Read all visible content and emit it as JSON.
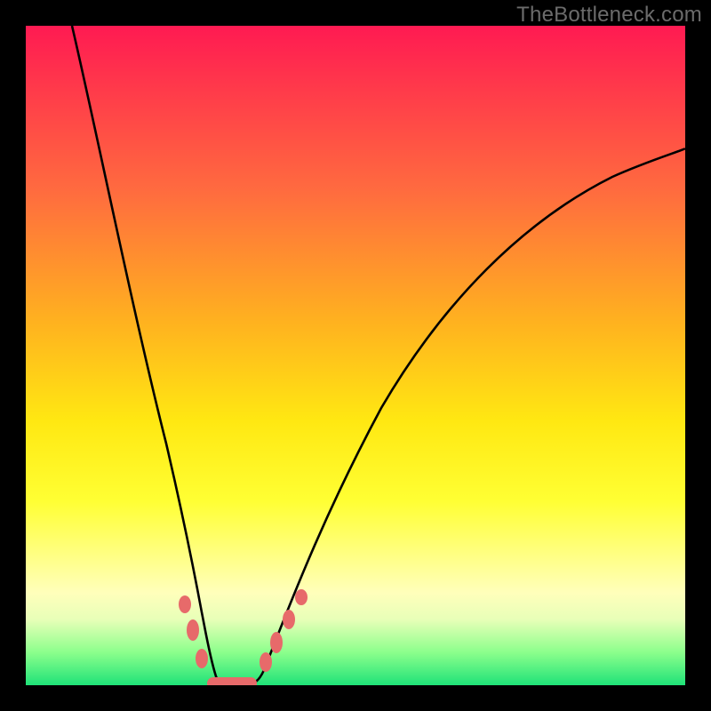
{
  "watermark": "TheBottleneck.com",
  "chart_data": {
    "type": "line",
    "title": "",
    "xlabel": "",
    "ylabel": "",
    "xlim": [
      0,
      100
    ],
    "ylim": [
      0,
      100
    ],
    "background_gradient": {
      "top": "#ff1a52",
      "mid_upper": "#ff8a2a",
      "mid": "#ffe812",
      "mid_lower": "#ffffbb",
      "bottom": "#1fe278"
    },
    "series": [
      {
        "name": "bottleneck-curve",
        "stroke": "#000000",
        "x": [
          7,
          10,
          14,
          18,
          21,
          24,
          26,
          28,
          30,
          34,
          38,
          42,
          48,
          56,
          66,
          78,
          92,
          100
        ],
        "y": [
          100,
          86,
          68,
          48,
          30,
          15,
          6,
          1,
          0,
          0,
          3,
          9,
          20,
          35,
          50,
          62,
          72,
          77
        ]
      }
    ],
    "markers": {
      "name": "highlight-dots",
      "fill": "#e76a6a",
      "points": [
        {
          "x": 23.5,
          "y": 12
        },
        {
          "x": 25.0,
          "y": 6
        },
        {
          "x": 26.5,
          "y": 2
        },
        {
          "x": 36.0,
          "y": 2
        },
        {
          "x": 38.0,
          "y": 4
        },
        {
          "x": 40.0,
          "y": 7
        },
        {
          "x": 42.0,
          "y": 10
        }
      ]
    },
    "flat_segment": {
      "name": "valley-bar",
      "fill": "#e76a6a",
      "x_start": 27,
      "x_end": 35,
      "y": 0
    }
  }
}
